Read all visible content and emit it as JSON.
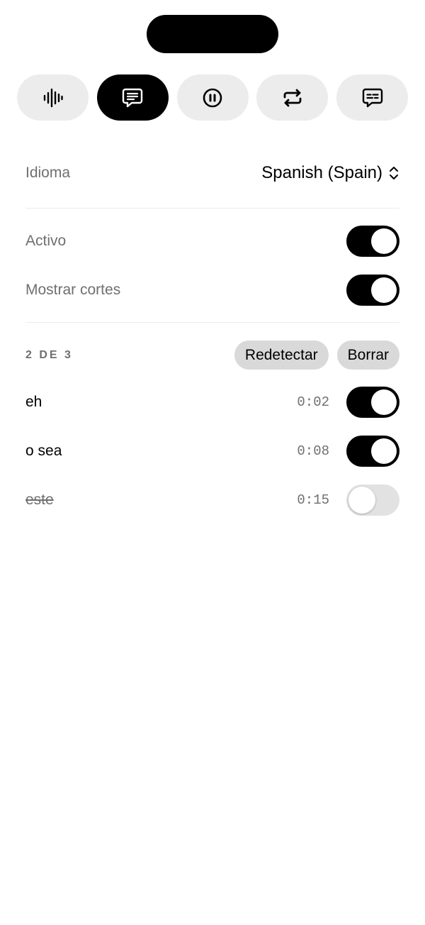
{
  "toolbar": {
    "buttons": [
      {
        "icon": "waveform-icon",
        "active": false
      },
      {
        "icon": "captions-bubble-icon",
        "active": true
      },
      {
        "icon": "pause-circle-icon",
        "active": false
      },
      {
        "icon": "repeat-icon",
        "active": false
      },
      {
        "icon": "subtitles-bubble-icon",
        "active": false
      }
    ]
  },
  "settings": {
    "language_label": "Idioma",
    "language_value": "Spanish (Spain)",
    "active_label": "Activo",
    "active_on": true,
    "show_cuts_label": "Mostrar cortes",
    "show_cuts_on": true
  },
  "fillers": {
    "count_label": "2 DE 3",
    "redetect_label": "Redetectar",
    "delete_label": "Borrar",
    "items": [
      {
        "word": "eh",
        "time": "0:02",
        "enabled": true
      },
      {
        "word": "o sea",
        "time": "0:08",
        "enabled": true
      },
      {
        "word": "este",
        "time": "0:15",
        "enabled": false
      }
    ]
  },
  "colors": {
    "accent": "#000000",
    "button_bg": "#ececec",
    "pill_bg": "#d9d9d9",
    "secondary_text": "#6f6f6f"
  }
}
